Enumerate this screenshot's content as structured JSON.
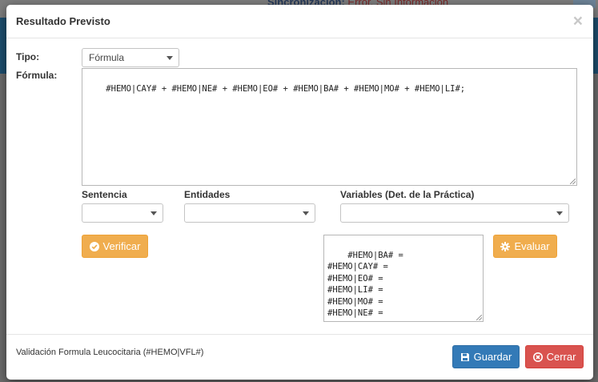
{
  "background": {
    "sync_label": "Sincronización:",
    "sync_status": "Error. Sin Información"
  },
  "modal": {
    "title": "Resultado Previsto",
    "close_symbol": "×"
  },
  "form": {
    "tipo_label": "Tipo:",
    "tipo_value": "Fórmula",
    "formula_label": "Fórmula:",
    "formula_value": "#HEMO|CAY# + #HEMO|NE# + #HEMO|EO# + #HEMO|BA# + #HEMO|MO# + #HEMO|LI#;",
    "sentencia_label": "Sentencia",
    "sentencia_value": "",
    "entidades_label": "Entidades",
    "entidades_value": "",
    "variables_label": "Variables (Det. de la Práctica)",
    "variables_value": "",
    "verify_label": "Verificar",
    "evaluate_label": "Evaluar",
    "evaluation_values": "#HEMO|BA# =\n#HEMO|CAY# =\n#HEMO|EO# =\n#HEMO|LI# =\n#HEMO|MO# =\n#HEMO|NE# ="
  },
  "footer": {
    "description": "Validación Formula Leucocitaria (#HEMO|VFL#)",
    "save_label": "Guardar",
    "close_label": "Cerrar"
  },
  "colors": {
    "warning": "#f0ad4e",
    "primary": "#337ab7",
    "danger": "#d9534f"
  },
  "icons": {
    "verify": "check-circle-icon",
    "evaluate": "gear-icon",
    "save": "floppy-disk-icon",
    "close": "times-circle-icon",
    "select_caret": "caret-down-icon"
  }
}
